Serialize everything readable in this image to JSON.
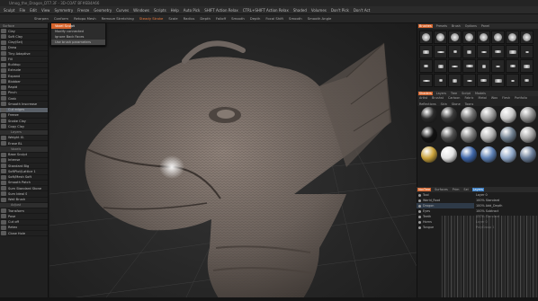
{
  "window": {
    "title": "Umog_the_Dragon_DT7.3F - 3D-COAT BF#EB4A66"
  },
  "menu": [
    "Sculpt",
    "File",
    "Edit",
    "View",
    "Symmetry",
    "Freeze",
    "Geometry",
    "Curves",
    "Windows",
    "Scripts",
    "Help",
    "Auto Pick",
    "SHIFT Action Relax",
    "CTRL+SHIFT Action Relax",
    "Shaded",
    "Volumes",
    "Don't Pick",
    "Don't Act"
  ],
  "toolbar": {
    "items": [
      "Sharpen",
      "Conform",
      "Retopo Mesh",
      "Remove Stretching",
      "Steady Stroke",
      "Scale",
      "Radius",
      "Depth",
      "Falloff",
      "Smooth",
      "Depth",
      "Focal Shift",
      "Smooth",
      "Smooth Angle"
    ]
  },
  "popup": {
    "items": [
      "Voxel Sculpt",
      "Modify connected",
      "Ignore Back Faces",
      "Use brush parameters"
    ]
  },
  "left_panel": {
    "header": "Surface",
    "rows": [
      {
        "label": "Clay",
        "kind": "tool"
      },
      {
        "label": "Soft Clay",
        "kind": "tool"
      },
      {
        "label": "Clay(Sel)",
        "kind": "tool"
      },
      {
        "label": "Draw",
        "kind": "tool"
      },
      {
        "label": "Tiny Adaptive",
        "kind": "tool"
      },
      {
        "label": "Fill",
        "kind": "tool"
      },
      {
        "label": "Buildup",
        "kind": "tool"
      },
      {
        "label": "Extrude",
        "kind": "tool"
      },
      {
        "label": "Expand",
        "kind": "tool"
      },
      {
        "label": "Blobber",
        "kind": "tool"
      },
      {
        "label": "Rapid",
        "kind": "tool"
      },
      {
        "label": "Pinch",
        "kind": "tool"
      },
      {
        "label": "Grab",
        "kind": "tool"
      },
      {
        "label": "Smooth Inscrease",
        "kind": "tool"
      },
      {
        "label": "Cut edges",
        "kind": "active"
      },
      {
        "label": "Freeze",
        "kind": "tool"
      },
      {
        "label": "Snake Clay",
        "kind": "tool"
      },
      {
        "label": "Copy Clay",
        "kind": "tool"
      },
      {
        "label": "Layers",
        "kind": "section"
      },
      {
        "label": "Weight Xl.",
        "kind": "tool"
      },
      {
        "label": "Erase  BL",
        "kind": "tool"
      },
      {
        "label": "Voxels",
        "kind": "section"
      },
      {
        "label": "Base Sculpt",
        "kind": "tool"
      },
      {
        "label": "Intense",
        "kind": "tool"
      },
      {
        "label": "Standard Big",
        "kind": "tool"
      },
      {
        "label": "SoftPlot/Lattice 1",
        "kind": "tool"
      },
      {
        "label": "Soft/Mesh Soft",
        "kind": "tool"
      },
      {
        "label": "Smooth Patch",
        "kind": "tool"
      },
      {
        "label": "Sum Standard Stone",
        "kind": "tool"
      },
      {
        "label": "Sum Ideal S",
        "kind": "tool"
      },
      {
        "label": "Wall Brush",
        "kind": "tool"
      },
      {
        "label": "Adjust",
        "kind": "section"
      },
      {
        "label": "Transform",
        "kind": "tool"
      },
      {
        "label": "Pose",
        "kind": "tool"
      },
      {
        "label": "Cut off",
        "kind": "tool"
      },
      {
        "label": "Retex",
        "kind": "tool"
      },
      {
        "label": "Close Hole",
        "kind": "tool"
      }
    ]
  },
  "right_panel": {
    "top_tabs": [
      {
        "label": "Brushes",
        "state": "active"
      },
      {
        "label": "Presets",
        "state": ""
      },
      {
        "label": "Brush",
        "state": ""
      },
      {
        "label": "Options",
        "state": ""
      },
      {
        "label": "Panel",
        "state": ""
      }
    ],
    "matcap_tabs": [
      {
        "label": "Shaders",
        "state": "active"
      },
      {
        "label": "Layers",
        "state": ""
      },
      {
        "label": "Tree",
        "state": ""
      },
      {
        "label": "Script",
        "state": ""
      },
      {
        "label": "Models",
        "state": ""
      }
    ],
    "matcap_subtabs": [
      "Artist",
      "Brushst",
      "Cartoon",
      "Fabric",
      "Metal",
      "Wax",
      "Flesh",
      "Portfolio",
      "Reflections",
      "Skin",
      "Stone",
      "Toons"
    ],
    "outliner_tabs": [
      {
        "label": "VoxTree",
        "state": "active"
      },
      {
        "label": "Surfaces",
        "state": ""
      },
      {
        "label": "Prim",
        "state": ""
      },
      {
        "label": "Sel",
        "state": ""
      },
      {
        "label": "Layers",
        "state": "blue"
      }
    ],
    "outliner_rows": [
      {
        "label": "Tool",
        "sel": false
      },
      {
        "label": "World_Root",
        "sel": false
      },
      {
        "label": "Dragon",
        "sel": true
      },
      {
        "label": "Eyes",
        "sel": false
      },
      {
        "label": "Teeth",
        "sel": false
      },
      {
        "label": "Horns",
        "sel": false
      },
      {
        "label": "Tongue",
        "sel": false
      }
    ],
    "layer_rows": [
      "Layer 0",
      "100%  Standard",
      "100%  Add_Depth",
      "100%  Subtract",
      "100%  Standard",
      "Layer 0",
      "PolyGroup 1"
    ]
  },
  "colors": {
    "accent": "#d5642c",
    "selection_blue": "#3a7fc6"
  }
}
